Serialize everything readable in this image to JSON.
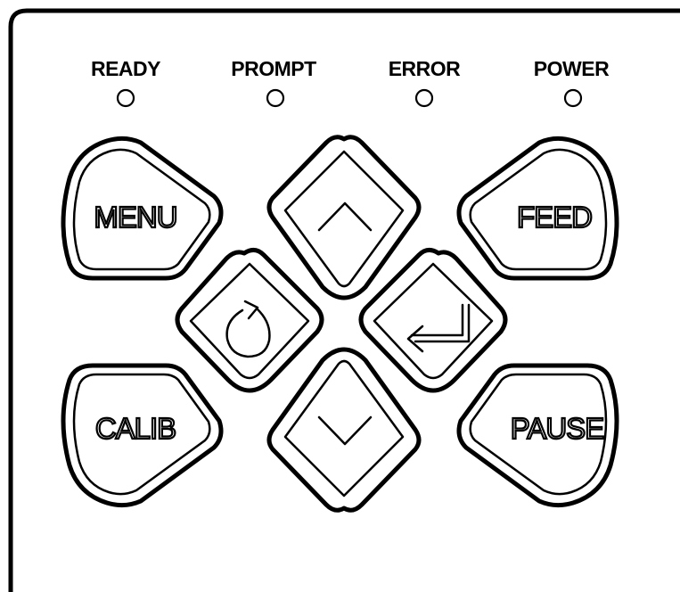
{
  "leds": [
    {
      "label": "READY"
    },
    {
      "label": "PROMPT"
    },
    {
      "label": "ERROR"
    },
    {
      "label": "POWER"
    }
  ],
  "buttons": {
    "menu": "MENU",
    "feed": "FEED",
    "calib": "CALIB",
    "pause": "PAUSE"
  },
  "icons": {
    "up": "chevron-up-icon",
    "down": "chevron-down-icon",
    "cancel": "rotate-arrow-icon",
    "enter": "enter-return-icon"
  },
  "colors": {
    "stroke": "#000000",
    "fill": "#ffffff"
  }
}
